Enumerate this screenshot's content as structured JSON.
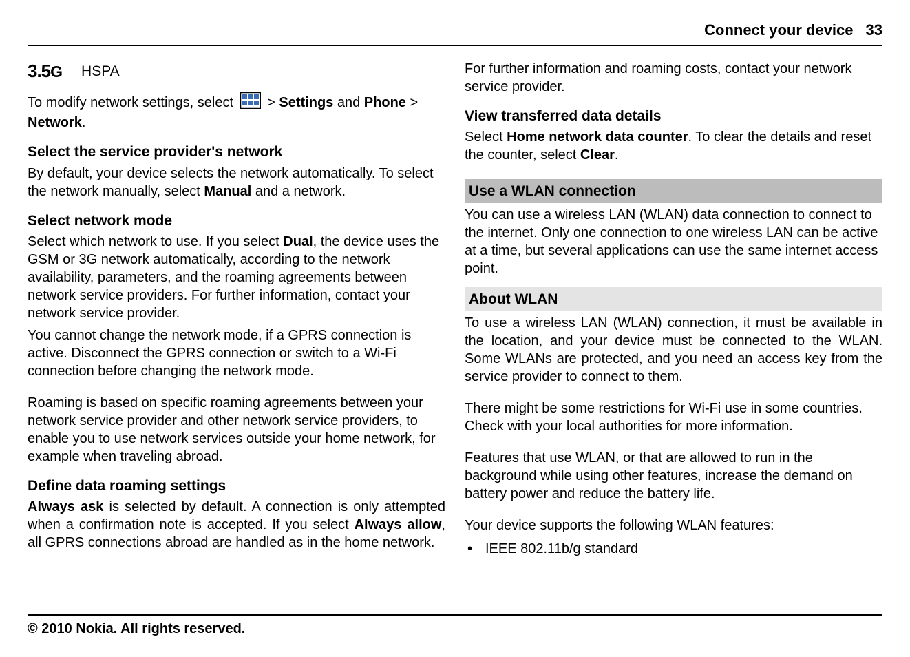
{
  "header": {
    "title": "Connect your device",
    "page": "33"
  },
  "left": {
    "g35": "3.5",
    "gLetter": "G",
    "hspa": "HSPA",
    "modify_pre": "To modify network settings, select ",
    "modify_gt": " > ",
    "modify_settings": "Settings",
    "modify_and": " and ",
    "phone": "Phone",
    "gt2": " > ",
    "network": "Network",
    "period": ".",
    "h_select_provider": "Select the service provider's network",
    "p_select_provider_1": "By default, your device selects the network automatically. To select the network manually, select ",
    "manual": "Manual",
    "p_select_provider_2": " and a network.",
    "h_select_mode": "Select network mode",
    "p_mode_1a": "Select which network to use. If you select ",
    "dual": "Dual",
    "p_mode_1b": ", the device uses the GSM or 3G network automatically, according to the network availability, parameters, and the roaming agreements between network service providers. For further information, contact your network service provider.",
    "p_mode_2": "You cannot change the network mode, if a GPRS connection is active. Disconnect the GPRS connection or switch to a Wi-Fi connection before changing the network mode.",
    "p_roaming": "Roaming is based on specific roaming agreements between your network service provider and other network service providers, to enable you to use network services outside your home network, for example when traveling abroad.",
    "h_define_roaming": "Define data roaming settings",
    "always_ask": "Always ask",
    "p_define_1": " is selected by default. A connection is only attempted when a confirmation note is accepted. If you select ",
    "always_allow": "Always allow",
    "p_define_2": ", all GPRS connections abroad are handled as in the home network."
  },
  "right": {
    "p_further": "For further information and roaming costs, contact your network service provider.",
    "h_view": "View transferred data details",
    "p_view_1": "Select ",
    "home_counter": "Home network data counter",
    "p_view_2": ". To clear the details and reset the counter, select ",
    "clear": "Clear",
    "p_view_3": ".",
    "bar_use_wlan": "Use a WLAN connection",
    "p_use_wlan": "You can use a wireless LAN (WLAN) data connection to connect to the internet. Only one connection to one wireless LAN can be active at a time, but several applications can use the same internet access point.",
    "bar_about_wlan": "About WLAN",
    "p_about_1": "To use a wireless LAN (WLAN) connection, it must be available in the location, and your device must be connected to the WLAN. Some WLANs are protected, and you need an access key from the service provider to connect to them.",
    "p_about_2": "There might be some restrictions for Wi-Fi use in some countries. Check with your local authorities for more information.",
    "p_about_3": "Features that use WLAN, or that are allowed to run in the background while using other features, increase the demand on battery power and reduce the battery life.",
    "p_about_4": "Your device supports the following WLAN features:",
    "bullet1": "IEEE 802.11b/g standard"
  },
  "footer": "© 2010 Nokia. All rights reserved."
}
